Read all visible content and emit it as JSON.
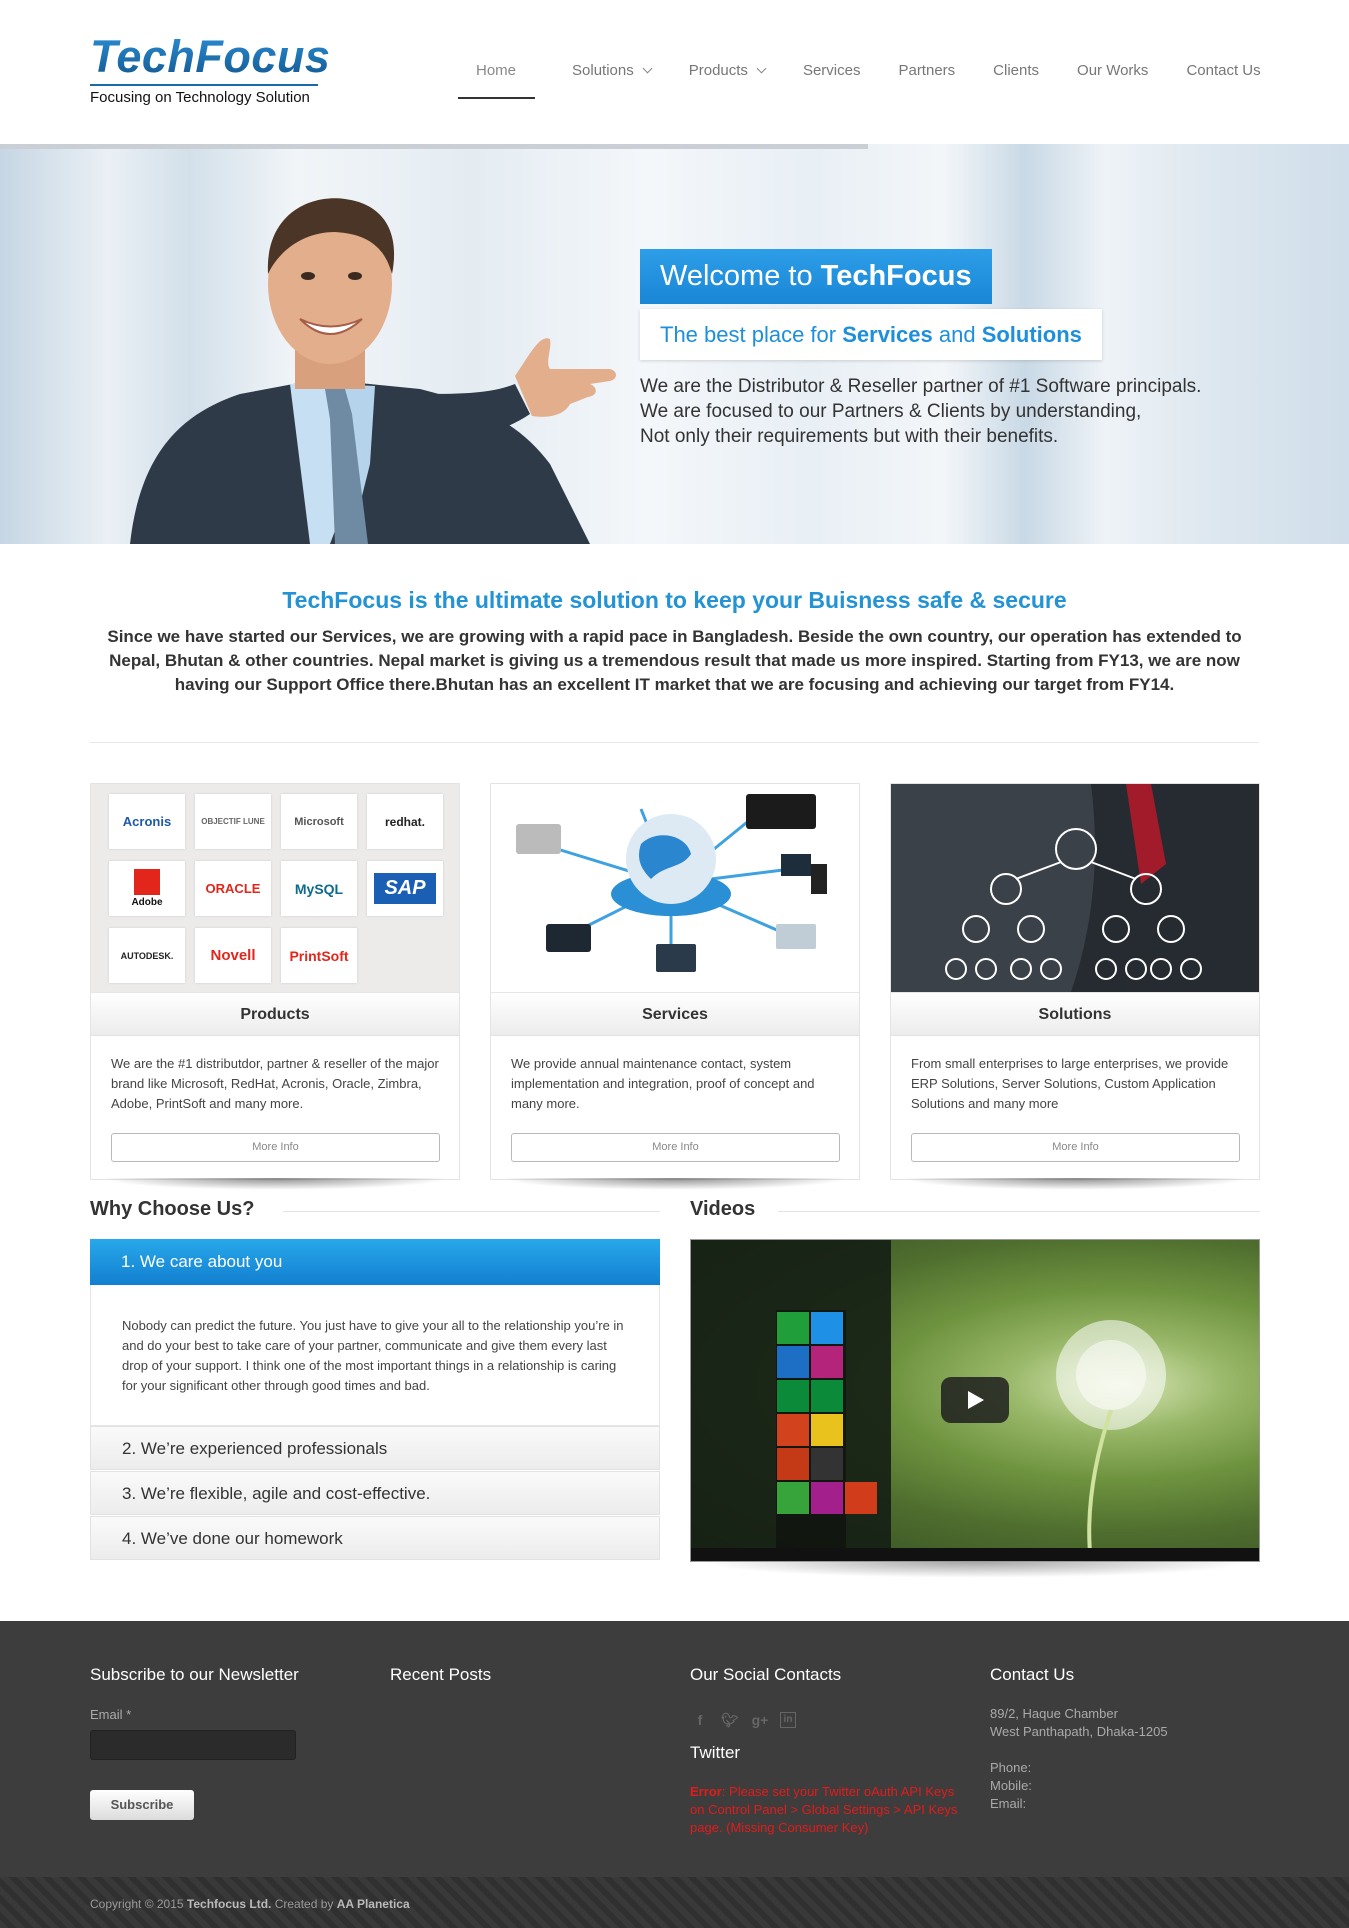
{
  "header": {
    "logo_title": "TechFocus",
    "logo_subtitle": "Focusing on Technology Solution",
    "nav": [
      {
        "label": "Home"
      },
      {
        "label": "Solutions"
      },
      {
        "label": "Products"
      },
      {
        "label": "Services"
      },
      {
        "label": "Partners"
      },
      {
        "label": "Clients"
      },
      {
        "label": "Our Works"
      },
      {
        "label": "Contact Us"
      }
    ]
  },
  "hero": {
    "title_prefix": "Welcome to ",
    "title_brand": "TechFocus",
    "sub_prefix": "The best place for ",
    "sub_services": "Services",
    "sub_and": " and ",
    "sub_solutions": "Solutions",
    "lines": [
      "We are the Distributor & Reseller partner of #1 Software principals.",
      "We are focused to our Partners & Clients by understanding,",
      "Not only their requirements but with their benefits."
    ]
  },
  "intro": {
    "title": "TechFocus is the ultimate solution to keep your Buisness safe & secure",
    "text": "Since we have started our Services, we are growing with a rapid pace in Bangladesh. Beside the own country, our operation has extended to Nepal, Bhutan & other countries. Nepal market is giving us a tremendous result that made us more inspired. Starting from FY13, we are now having our Support Office there.Bhutan has an excellent IT market that we are focusing and achieving our target from FY14."
  },
  "cards": [
    {
      "title": "Products",
      "text": "We are the #1 distributdor, partner & reseller of the major brand like Microsoft, RedHat, Acronis, Oracle, Zimbra, Adobe, PrintSoft and many more.",
      "button": "More Info"
    },
    {
      "title": "Services",
      "text": "We provide annual maintenance contact, system implementation and integration, proof of concept and many more.",
      "button": "More Info"
    },
    {
      "title": "Solutions",
      "text": "From small enterprises to large enterprises, we provide ERP Solutions, Server Solutions, Custom Application Solutions and many more",
      "button": "More Info"
    }
  ],
  "brand_logos": [
    "Acronis",
    "OBJECTIF LUNE",
    "Microsoft",
    "redhat.",
    "Adobe",
    "ORACLE",
    "MySQL",
    "SAP",
    "AUTODESK.",
    "Novell",
    "PrintSoft"
  ],
  "why": {
    "title": "Why Choose Us?",
    "items": [
      {
        "label": "1. We care about you"
      },
      {
        "label": "2. We’re experienced professionals"
      },
      {
        "label": "3. We’re flexible, agile and cost-effective."
      },
      {
        "label": "4. We’ve done our homework"
      }
    ],
    "open_text": "Nobody can predict the future. You just have to give your all to the relationship you’re in and do your best to take care of your partner, communicate and give them every last drop of your support. I think one of the most important things in a relationship is caring for your significant other through good times and bad."
  },
  "videos": {
    "title": "Videos"
  },
  "footer": {
    "newsletter_title": "Subscribe to our Newsletter",
    "email_label": "Email *",
    "subscribe_button": "Subscribe",
    "recent_posts_title": "Recent Posts",
    "social_title": "Our Social Contacts",
    "social_icons": [
      "facebook-icon",
      "twitter-icon",
      "google-plus-icon",
      "linkedin-icon"
    ],
    "twitter_title": "Twitter",
    "twitter_error_label": "Error",
    "twitter_error_text": ": Please set your Twitter oAuth API Keys on Control Panel > Global Settings > API Keys page. (Missing Consumer Key)",
    "contact_title": "Contact Us",
    "address_line1": "89/2, Haque Chamber",
    "address_line2": "West Panthapath, Dhaka-1205",
    "phone_label": "Phone:",
    "mobile_label": "Mobile:",
    "email_contact_label": "Email:",
    "copyright_prefix": "Copyright © 2015 ",
    "copyright_company": "Techfocus Ltd.",
    "copyright_mid": " Created by ",
    "copyright_author": "AA Planetica"
  },
  "colors": {
    "brand_blue": "#2393d4",
    "accordion_active": "#1a8ad9",
    "footer_bg": "#3d3d3d",
    "error_red": "#e21b1b"
  }
}
